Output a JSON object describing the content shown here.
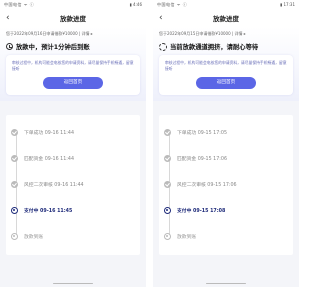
{
  "colors": {
    "accent": "#5b66e6",
    "current_step": "#1f2b7a",
    "done_step": "#bbbbbb",
    "desc_text": "#6a6fb8"
  },
  "left": {
    "status_bar": {
      "left": "中国电信 ᯤ ⓘ",
      "right": "▮ 4:46"
    },
    "nav": {
      "back_icon": "back-arrow-icon",
      "title": "放款进度"
    },
    "loan_info": "您于2022年09月16日申请借款¥10000 | 详情 ▸",
    "status_icon": "clock-icon",
    "status_text": "放款中，预计1分钟后到账",
    "card_desc": "审核过程中，机构可能会电核您的申请资料，请尽量保持手机畅通，留意接听",
    "button": "返回首页",
    "steps": [
      {
        "label": "下单成功 09-16 11:44",
        "state": "done"
      },
      {
        "label": "匹配资金 09-16 11:44",
        "state": "done"
      },
      {
        "label": "风控二次审核 09-16 11:44",
        "state": "done"
      },
      {
        "label": "支付中 09-16 11:45",
        "state": "current"
      },
      {
        "label": "放款到账",
        "state": "pending"
      }
    ]
  },
  "right": {
    "status_bar": {
      "left": "中国电信 ᯤ ⓘ",
      "right": "▮ 17:31"
    },
    "nav": {
      "back_icon": "back-arrow-icon",
      "title": "放款进度"
    },
    "loan_info": "您于2022年09月15日申请借款¥10000 | 详情 ▸",
    "status_icon": "spinner-icon",
    "status_text": "当前放款通道拥挤，请耐心等待",
    "card_desc": "审核过程中，机构可能会电核您的申请资料，请尽量保持手机畅通，留意接听",
    "button": "返回首页",
    "steps": [
      {
        "label": "下单成功 09-15 17:05",
        "state": "done"
      },
      {
        "label": "匹配资金 09-15 17:06",
        "state": "done"
      },
      {
        "label": "风控二次审核 09-15 17:06",
        "state": "done"
      },
      {
        "label": "支付中 09-15 17:08",
        "state": "current"
      },
      {
        "label": "放款到账",
        "state": "pending"
      }
    ]
  }
}
